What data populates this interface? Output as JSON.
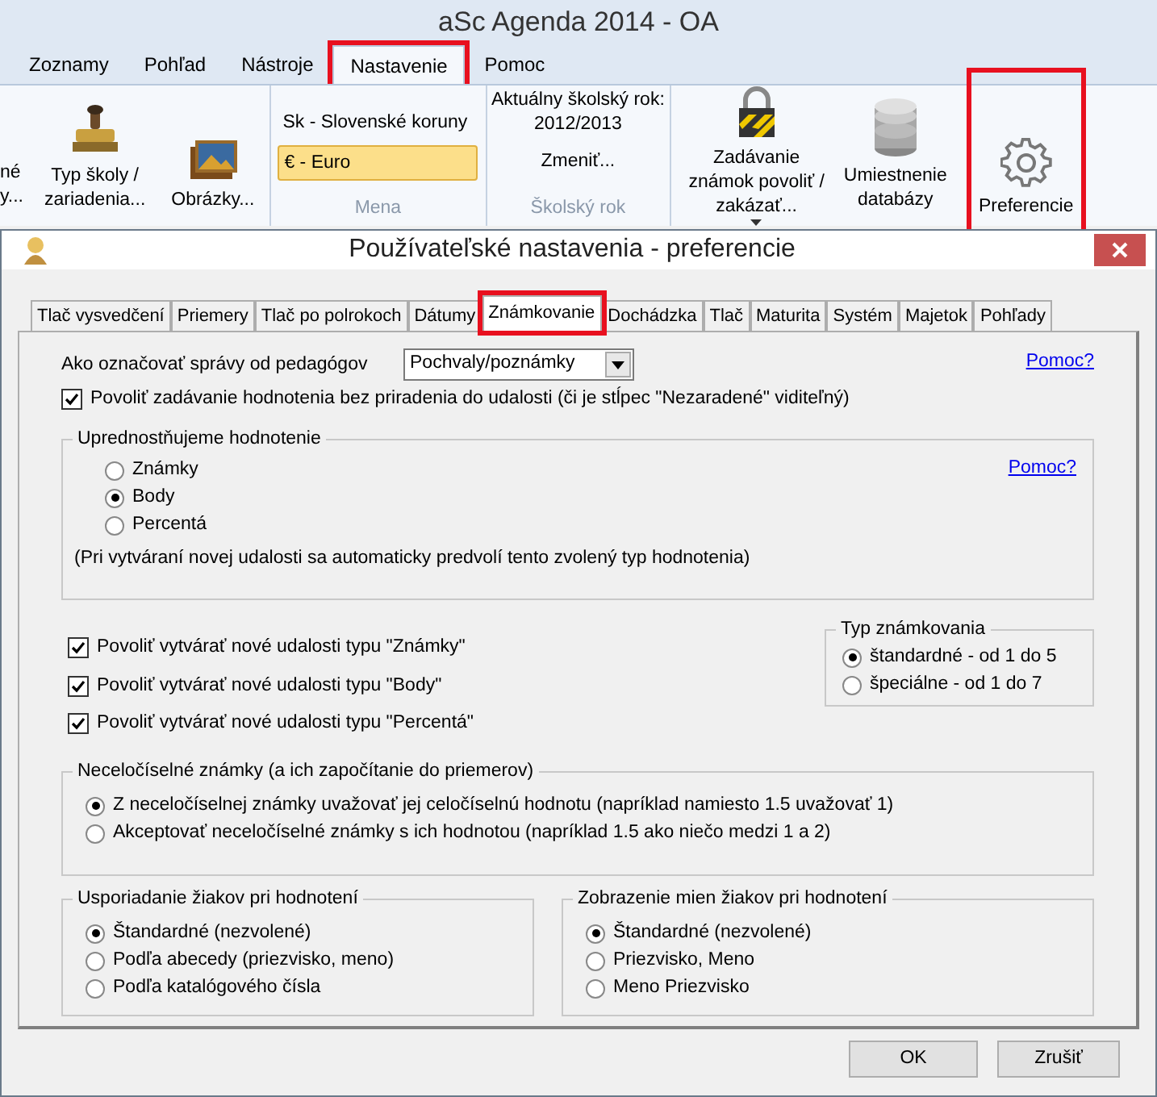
{
  "app": {
    "title": "aSc Agenda 2014 - OA",
    "tabs": [
      {
        "label": "Zoznamy",
        "selected": false,
        "highlighted": false
      },
      {
        "label": "Pohľad",
        "selected": false,
        "highlighted": false
      },
      {
        "label": "Nástroje",
        "selected": false,
        "highlighted": false
      },
      {
        "label": "Nastavenie",
        "selected": true,
        "highlighted": true
      },
      {
        "label": "Pomoc",
        "selected": false,
        "highlighted": false
      }
    ],
    "ribbon": {
      "cut_button": [
        "né",
        "y..."
      ],
      "school_type_button": "Typ školy / zariadenia...",
      "pictures_button": "Obrázky...",
      "currency": {
        "label": "Mena",
        "options": [
          {
            "label": "Sk - Slovenské koruny",
            "selected": false
          },
          {
            "label": "€ - Euro",
            "selected": true
          }
        ]
      },
      "school_year": {
        "label": "Školský rok",
        "caption": "Aktuálny školský rok:",
        "value": "2012/2013",
        "change_button": "Zmeniť..."
      },
      "grades_lock_button": "Zadávanie známok povoliť / zakázať...",
      "database_button": "Umiestnenie databázy",
      "preferences_button": {
        "label": "Preferencie",
        "highlighted": true
      }
    }
  },
  "dialog": {
    "title": "Používateľské nastavenia - preferencie",
    "tabs": [
      {
        "label": "Tlač vysvedčení",
        "selected": false,
        "highlighted": false
      },
      {
        "label": "Priemery",
        "selected": false,
        "highlighted": false
      },
      {
        "label": "Tlač po polrokoch",
        "selected": false,
        "highlighted": false
      },
      {
        "label": "Dátumy",
        "selected": false,
        "highlighted": false
      },
      {
        "label": "Známkovanie",
        "selected": true,
        "highlighted": true
      },
      {
        "label": "Dochádzka",
        "selected": false,
        "highlighted": false
      },
      {
        "label": "Tlač",
        "selected": false,
        "highlighted": false
      },
      {
        "label": "Maturita",
        "selected": false,
        "highlighted": false
      },
      {
        "label": "Systém",
        "selected": false,
        "highlighted": false
      },
      {
        "label": "Majetok",
        "selected": false,
        "highlighted": false
      },
      {
        "label": "Pohľady",
        "selected": false,
        "highlighted": false
      }
    ],
    "messages_label": "Ako označovať správy od pedagógov",
    "messages_value": "Pochvaly/poznámky",
    "help_link": "Pomoc?",
    "allow_unassigned": {
      "label": "Povoliť zadávanie hodnotenia bez priradenia do udalosti (či je stĺpec \"Nezaradené\" viditeľný)",
      "checked": true
    },
    "preferred": {
      "title": "Uprednostňujeme hodnotenie",
      "help_link": "Pomoc?",
      "options": [
        {
          "label": "Známky",
          "selected": false
        },
        {
          "label": "Body",
          "selected": true
        },
        {
          "label": "Percentá",
          "selected": false
        }
      ],
      "note": "(Pri vytváraní novej udalosti sa automaticky predvolí tento zvolený typ hodnotenia)"
    },
    "allow_types": [
      {
        "label": "Povoliť vytvárať nové udalosti typu \"Známky\"",
        "checked": true
      },
      {
        "label": "Povoliť vytvárať nové udalosti typu \"Body\"",
        "checked": true
      },
      {
        "label": "Povoliť vytvárať nové udalosti typu \"Percentá\"",
        "checked": true
      }
    ],
    "grading_type": {
      "title": "Typ známkovania",
      "options": [
        {
          "label": "štandardné - od 1 do 5",
          "selected": true
        },
        {
          "label": "špeciálne - od 1 do 7",
          "selected": false
        }
      ]
    },
    "non_integer": {
      "title": "Neceločíselné známky (a ich započítanie do priemerov)",
      "options": [
        {
          "label": "Z neceločíselnej známky uvažovať jej celočíselnú hodnotu (napríklad namiesto 1.5 uvažovať 1)",
          "selected": true
        },
        {
          "label": "Akceptovať neceločíselné známky s ich hodnotou (napríklad 1.5 ako niečo medzi 1 a 2)",
          "selected": false
        }
      ]
    },
    "ordering": {
      "title": "Usporiadanie žiakov pri hodnotení",
      "options": [
        {
          "label": "Štandardné (nezvolené)",
          "selected": true
        },
        {
          "label": "Podľa abecedy (priezvisko, meno)",
          "selected": false
        },
        {
          "label": "Podľa katalógového čísla",
          "selected": false
        }
      ]
    },
    "names": {
      "title": "Zobrazenie mien žiakov pri hodnotení",
      "options": [
        {
          "label": "Štandardné (nezvolené)",
          "selected": true
        },
        {
          "label": "Priezvisko, Meno",
          "selected": false
        },
        {
          "label": "Meno Priezvisko",
          "selected": false
        }
      ]
    },
    "buttons": [
      "OK",
      "Zrušiť"
    ]
  }
}
